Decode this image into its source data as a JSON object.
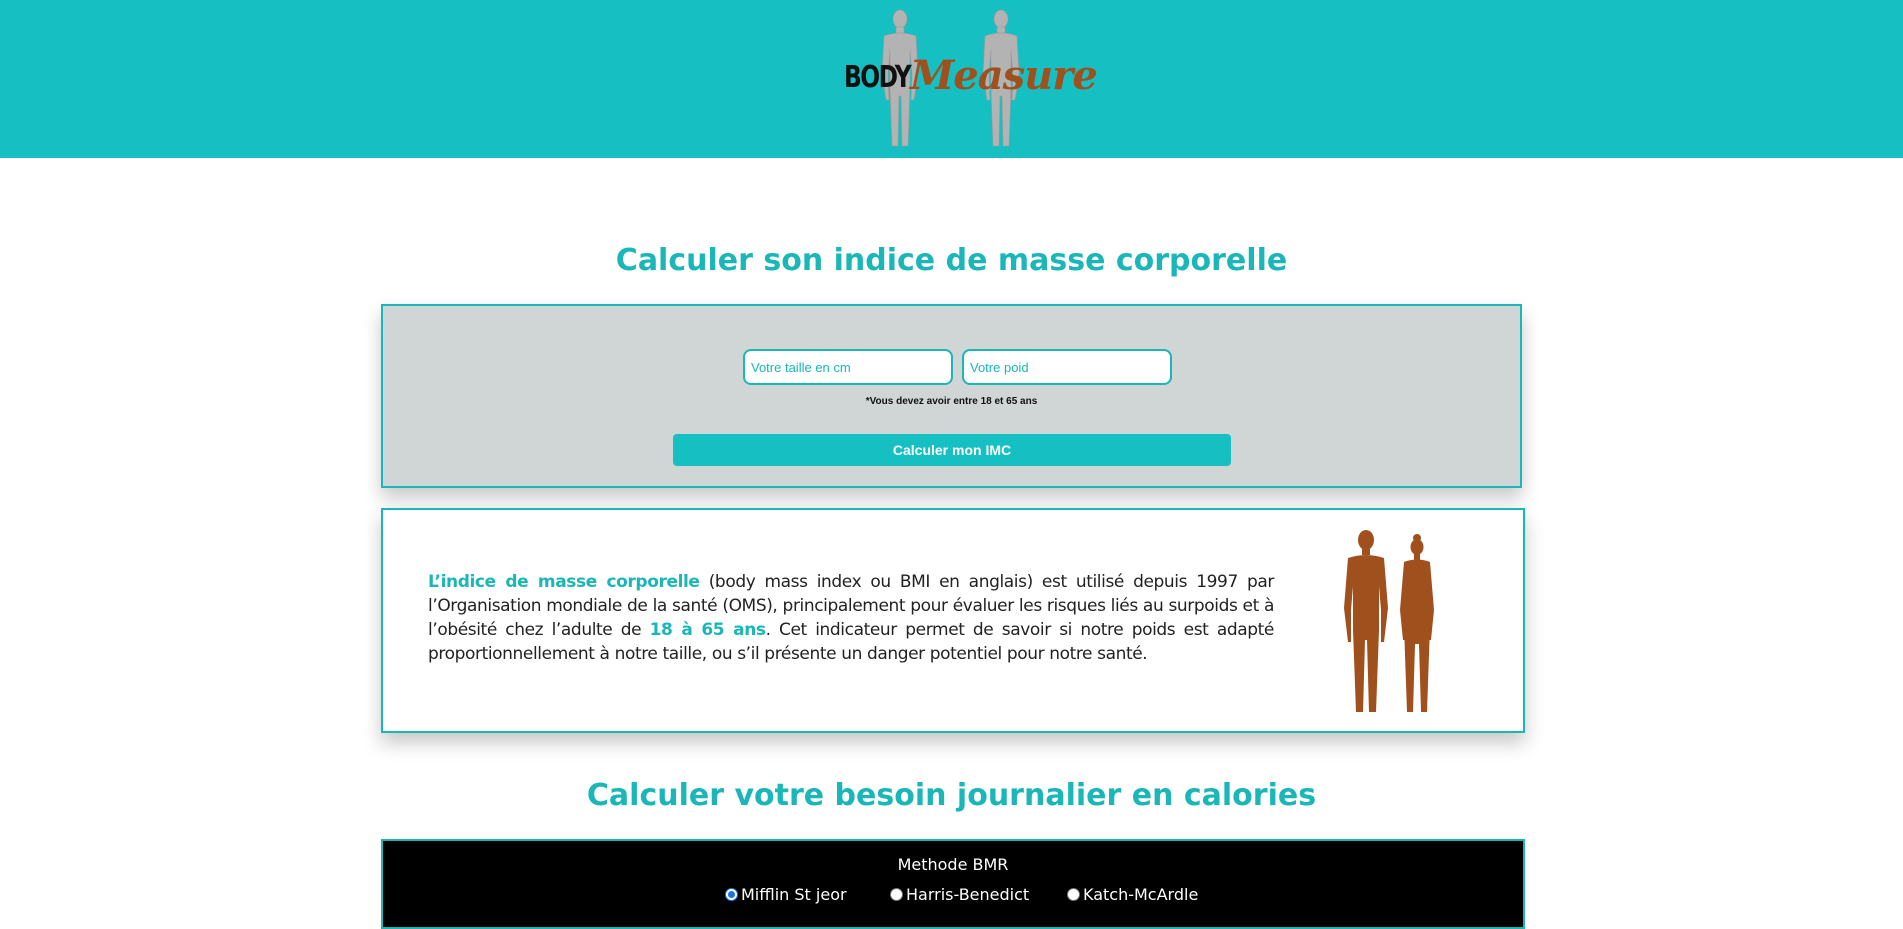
{
  "header": {
    "logo_word_1": "BODY",
    "logo_word_2": "Measure"
  },
  "imc": {
    "title": "Calculer son indice de masse corporelle",
    "height_placeholder": "Votre taille en cm",
    "weight_placeholder": "Votre poid",
    "age_note": "*Vous devez avoir entre 18 et 65 ans",
    "button_label": "Calculer mon IMC"
  },
  "info": {
    "highlight_1": "L’indice de masse corporelle",
    "text_1": " (body mass index ou BMI en anglais) est utilisé depuis 1997 par l’Organisation mondiale de la santé (OMS), principalement pour évaluer les risques liés au surpoids et à l’obésité chez l’adulte de ",
    "highlight_2": "18 à 65 ans",
    "text_2": ". Cet indicateur permet de savoir si notre poids est adapté proportionnellement à notre taille, ou s’il présente un danger potentiel pour notre santé."
  },
  "calories": {
    "title": "Calculer votre besoin journalier en calories",
    "method_title": "Methode BMR",
    "options": [
      {
        "label": "Mifflin St jeor",
        "checked": true
      },
      {
        "label": "Harris-Benedict",
        "checked": false
      },
      {
        "label": "Katch-McArdle",
        "checked": false
      }
    ]
  },
  "colors": {
    "accent": "#16c0c2",
    "brand_brown": "#a0501d",
    "form_bg": "#d0d5d6"
  }
}
